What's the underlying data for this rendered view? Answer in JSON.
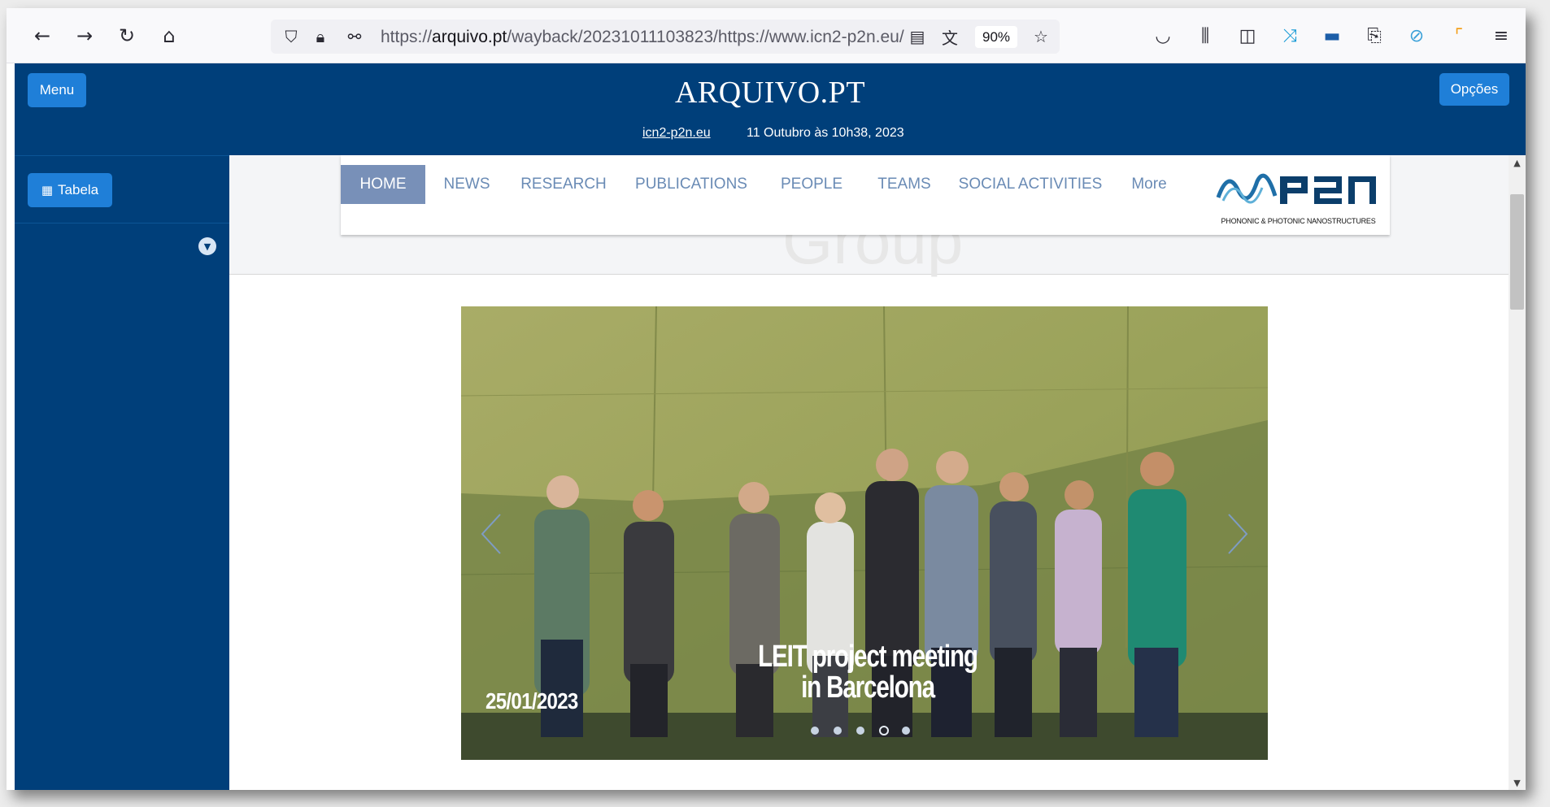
{
  "browser": {
    "url_scheme": "https://",
    "url_domain": "arquivo.pt",
    "url_path": "/wayback/20231011103823/https://www.icn2-p2n.eu/",
    "zoom": "90%",
    "icons": [
      "back-icon",
      "forward-icon",
      "reload-icon",
      "home-icon",
      "shield-icon",
      "lock-icon",
      "permissions-icon",
      "reader-view-icon",
      "translate-icon",
      "bookmark-star-icon",
      "pocket-icon",
      "library-icon",
      "sidebar-icon",
      "extension-icon",
      "account-icon",
      "extensions-puzzle-icon",
      "link-icon",
      "addon-icon",
      "menu-icon"
    ]
  },
  "arquivo": {
    "menu_label": "Menu",
    "options_label": "Opções",
    "logo": "ARQUIVO.PT",
    "site_link": "icn2-p2n.eu",
    "capture_date": "11 Outubro às 10h38, 2023",
    "table_label": "Tabela",
    "header_color": "#003f7a",
    "button_color": "#1f7fd8"
  },
  "site": {
    "nav": [
      "HOME",
      "NEWS",
      "RESEARCH",
      "PUBLICATIONS",
      "PEOPLE",
      "TEAMS",
      "SOCIAL ACTIVITIES",
      "More"
    ],
    "active_nav": "HOME",
    "logo_text": "P2N",
    "logo_caption": "PHONONIC & PHOTONIC NANOSTRUCTURES",
    "faded_heading": "Group",
    "slide": {
      "date": "25/01/2023",
      "caption_line1": "LEIT project meeting",
      "caption_line2": "in Barcelona",
      "dot_count": 5,
      "active_dot": 4
    }
  }
}
